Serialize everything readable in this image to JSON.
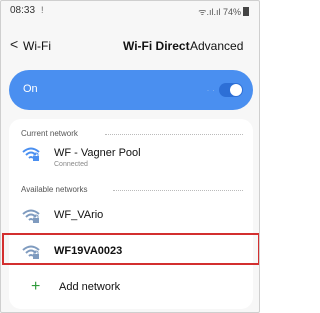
{
  "status_bar": {
    "time": "08:33",
    "notification": "!",
    "right": "ᯤ.ıl.ıl 74%"
  },
  "header": {
    "back_label": "<",
    "title": "Wi-Fi",
    "wifi_direct": "Wi-Fi Direct",
    "advanced": "Advanced"
  },
  "toggle_banner": {
    "label": "On",
    "state": true
  },
  "current_network": {
    "section_label": "Current network",
    "name": "WF - Vagner Pool",
    "status": "Connected"
  },
  "available_networks": {
    "section_label": "Available networks",
    "items": [
      {
        "name": "WF_VArio"
      },
      {
        "name": "WF19VA0023"
      }
    ]
  },
  "add_network": {
    "label": "Add network"
  },
  "colors": {
    "accent": "#4a8ff0",
    "highlight": "#d32f2f",
    "plus": "#2e9a3a"
  }
}
